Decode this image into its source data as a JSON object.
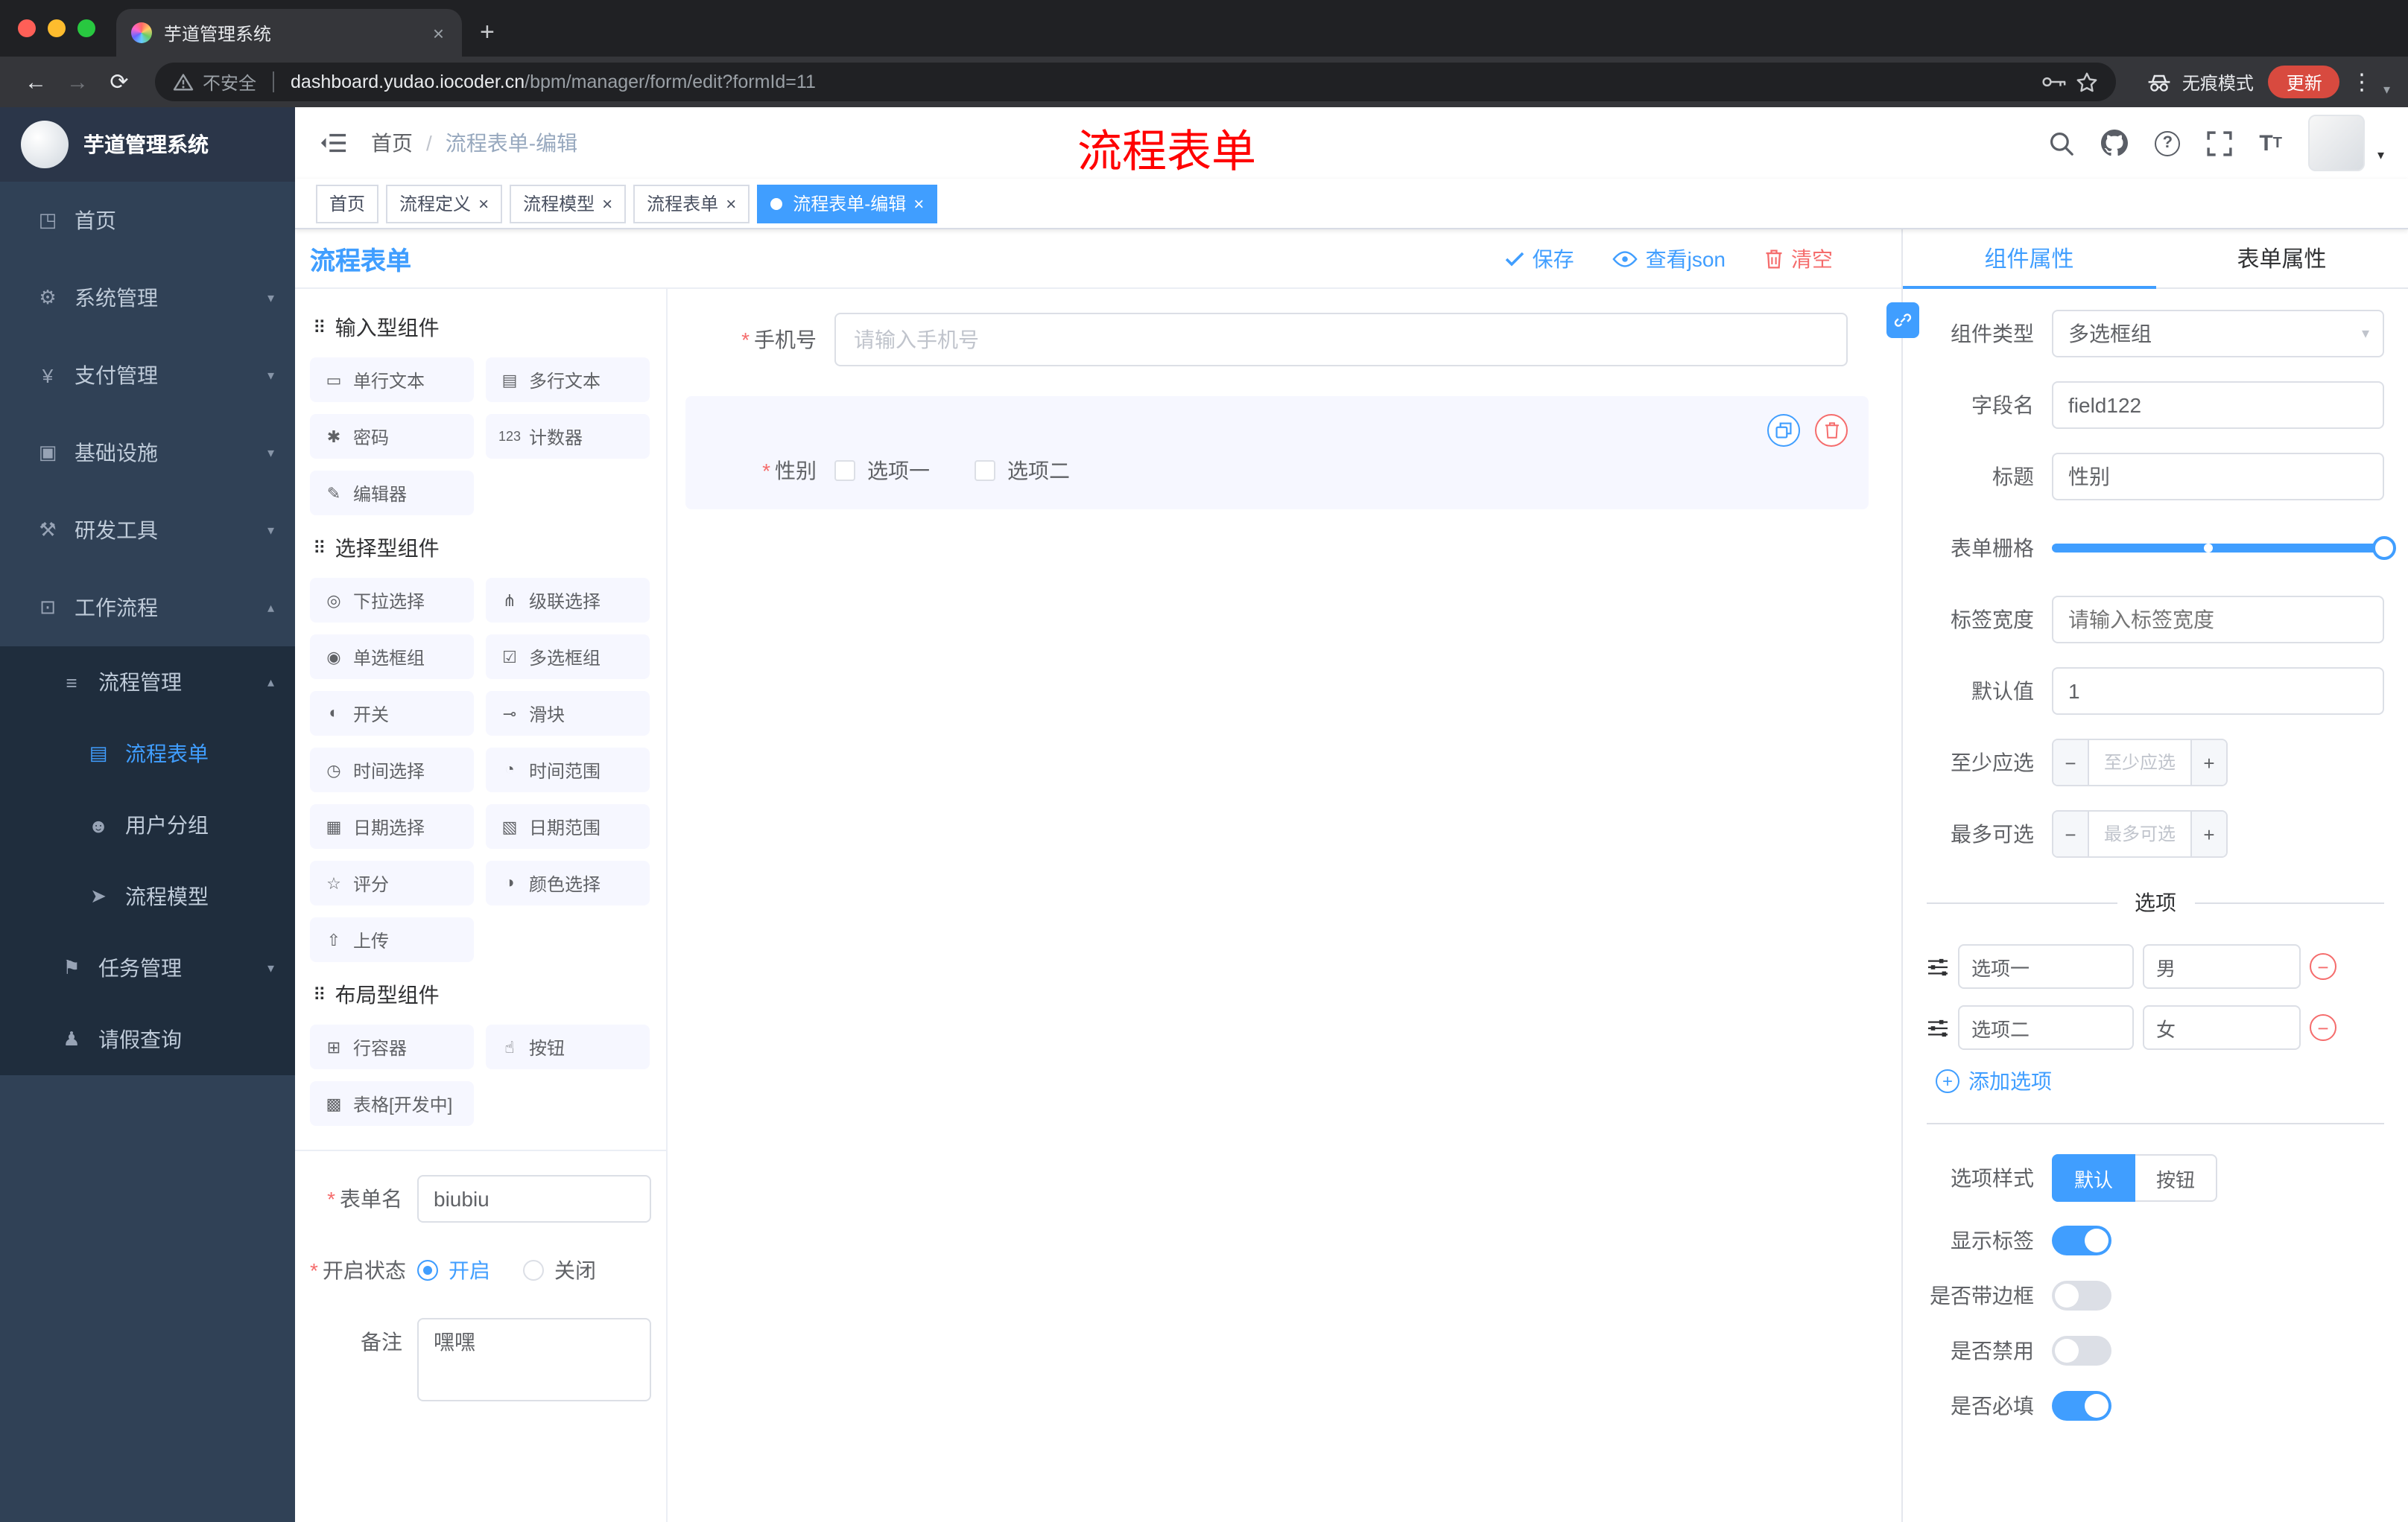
{
  "theme": {
    "primary": "#409EFF",
    "danger": "#F56C6C",
    "sidebar_bg": "#304156",
    "overlay_red": "#FF0000",
    "tab_active_bg": "#409EFF"
  },
  "browser": {
    "tab_title": "芋道管理系统",
    "security_label": "不安全",
    "url_domain": "dashboard.yudao.iocoder.cn",
    "url_path": "/bpm/manager/form/edit?formId=11",
    "incognito_label": "无痕模式",
    "update_label": "更新"
  },
  "sidebar": {
    "logo_title": "芋道管理系统",
    "items": [
      {
        "label": "首页",
        "glyph": "◳"
      },
      {
        "label": "系统管理",
        "glyph": "⚙"
      },
      {
        "label": "支付管理",
        "glyph": "¥"
      },
      {
        "label": "基础设施",
        "glyph": "▣"
      },
      {
        "label": "研发工具",
        "glyph": "⚒"
      },
      {
        "label": "工作流程",
        "glyph": "⊡"
      },
      {
        "label": "流程管理",
        "glyph": "≡"
      },
      {
        "label": "流程表单",
        "glyph": "▤"
      },
      {
        "label": "用户分组",
        "glyph": "☻"
      },
      {
        "label": "流程模型",
        "glyph": "➤"
      },
      {
        "label": "任务管理",
        "glyph": "⚑"
      },
      {
        "label": "请假查询",
        "glyph": "♟"
      }
    ]
  },
  "header": {
    "breadcrumb_home": "首页",
    "breadcrumb_sep": "/",
    "breadcrumb_current": "流程表单-编辑",
    "overlay_title": "流程表单"
  },
  "tags": [
    {
      "label": "首页"
    },
    {
      "label": "流程定义"
    },
    {
      "label": "流程模型"
    },
    {
      "label": "流程表单"
    },
    {
      "label": "流程表单-编辑"
    }
  ],
  "designer": {
    "title": "流程表单",
    "save_label": "保存",
    "view_json_label": "查看json",
    "clear_label": "清空",
    "palette": [
      {
        "title": "输入型组件",
        "items": [
          {
            "label": "单行文本",
            "glyph": "▭"
          },
          {
            "label": "多行文本",
            "glyph": "▤"
          },
          {
            "label": "密码",
            "glyph": "✱"
          },
          {
            "label": "计数器",
            "glyph": "123"
          },
          {
            "label": "编辑器",
            "glyph": "✎"
          }
        ]
      },
      {
        "title": "选择型组件",
        "items": [
          {
            "label": "下拉选择",
            "glyph": "◎"
          },
          {
            "label": "级联选择",
            "glyph": "⋔"
          },
          {
            "label": "单选框组",
            "glyph": "◉"
          },
          {
            "label": "多选框组",
            "glyph": "☑"
          },
          {
            "label": "开关",
            "glyph": "◐"
          },
          {
            "label": "滑块",
            "glyph": "⊸"
          },
          {
            "label": "时间选择",
            "glyph": "◷"
          },
          {
            "label": "时间范围",
            "glyph": "◔"
          },
          {
            "label": "日期选择",
            "glyph": "▦"
          },
          {
            "label": "日期范围",
            "glyph": "▧"
          },
          {
            "label": "评分",
            "glyph": "☆"
          },
          {
            "label": "颜色选择",
            "glyph": "◑"
          },
          {
            "label": "上传",
            "glyph": "⇧"
          }
        ]
      },
      {
        "title": "布局型组件",
        "items": [
          {
            "label": "行容器",
            "glyph": "⊞"
          },
          {
            "label": "按钮",
            "glyph": "☝"
          },
          {
            "label": "表格[开发中]",
            "glyph": "▩"
          }
        ]
      }
    ],
    "meta": {
      "name_label": "表单名",
      "name_value": "biubiu",
      "status_label": "开启状态",
      "status_on": "开启",
      "status_off": "关闭",
      "status_selected": "开启",
      "remark_label": "备注",
      "remark_value": "嘿嘿"
    },
    "canvas": {
      "phone_label": "手机号",
      "phone_placeholder": "请输入手机号",
      "gender_label": "性别",
      "gender_option1": "选项一",
      "gender_option2": "选项二"
    }
  },
  "properties": {
    "tab_component": "组件属性",
    "tab_form": "表单属性",
    "active_tab": "组件属性",
    "rows": {
      "type_label": "组件类型",
      "type_value": "多选框组",
      "field_label": "字段名",
      "field_value": "field122",
      "title_label": "标题",
      "title_value": "性别",
      "grid_label": "表单栅格",
      "grid_value_percent": 100,
      "grid_stop_percent": 47,
      "width_label": "标签宽度",
      "width_placeholder": "请输入标签宽度",
      "default_label": "默认值",
      "default_value": "1",
      "min_label": "至少应选",
      "min_placeholder": "至少应选",
      "max_label": "最多可选",
      "max_placeholder": "最多可选"
    },
    "options": {
      "divider_title": "选项",
      "rows": [
        {
          "label": "选项一",
          "value": "男"
        },
        {
          "label": "选项二",
          "value": "女"
        }
      ],
      "add_label": "添加选项"
    },
    "style_label": "选项样式",
    "style_default": "默认",
    "style_button": "按钮",
    "style_selected": "默认",
    "switch_rows": [
      {
        "label": "显示标签",
        "on": true
      },
      {
        "label": "是否带边框",
        "on": false
      },
      {
        "label": "是否禁用",
        "on": false
      },
      {
        "label": "是否必填",
        "on": true
      }
    ]
  }
}
